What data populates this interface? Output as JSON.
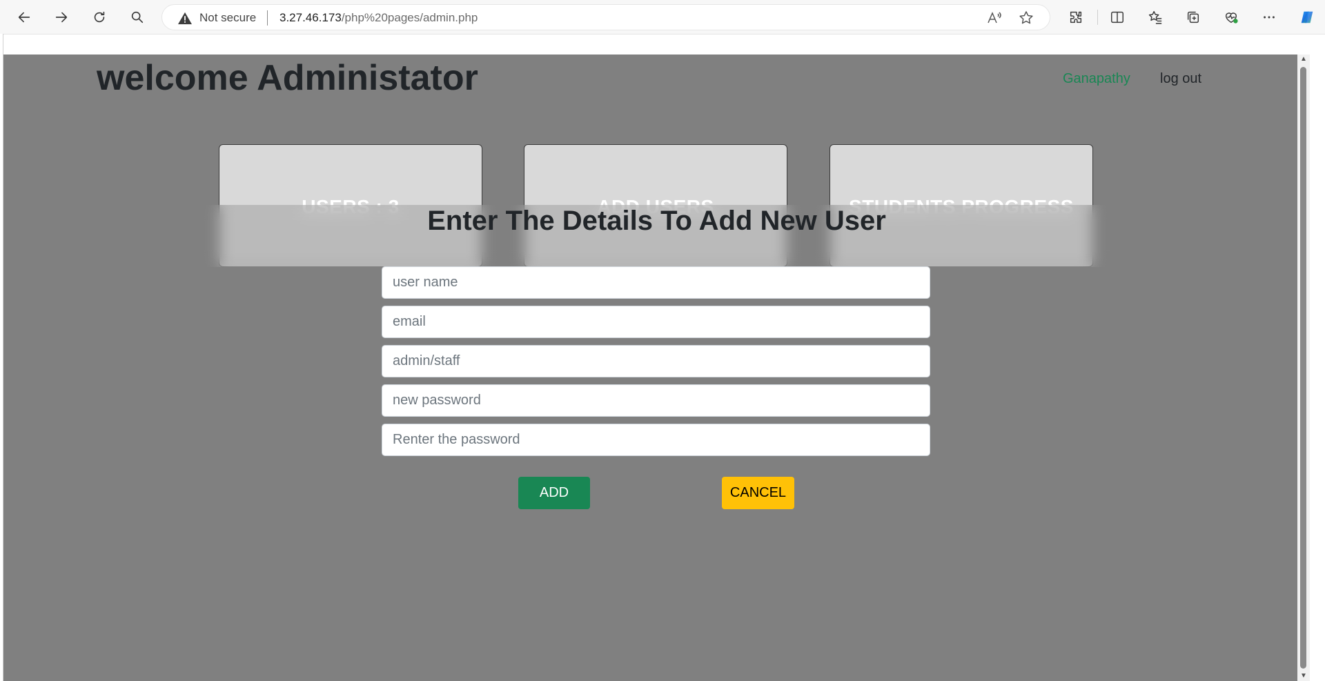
{
  "browser": {
    "security_label": "Not secure",
    "url_host": "3.27.46.173",
    "url_path": "/php%20pages/admin.php"
  },
  "header": {
    "title": "welcome Administator",
    "user_name": "Ganapathy",
    "logout_label": "log out"
  },
  "cards": [
    {
      "label": "USERS : 3"
    },
    {
      "label": "ADD USERS"
    },
    {
      "label": "STUDENTS PROGRESS"
    }
  ],
  "modal": {
    "title": "Enter The Details To Add New User",
    "fields": [
      {
        "placeholder": "user name",
        "value": ""
      },
      {
        "placeholder": "email",
        "value": ""
      },
      {
        "placeholder": "admin/staff",
        "value": ""
      },
      {
        "placeholder": "new password",
        "value": ""
      },
      {
        "placeholder": "Renter the password",
        "value": ""
      }
    ],
    "add_label": "ADD",
    "cancel_label": "CANCEL"
  },
  "colors": {
    "page_overlay": "#808080",
    "success": "#198754",
    "warning": "#ffc107",
    "text_dark": "#212529"
  }
}
